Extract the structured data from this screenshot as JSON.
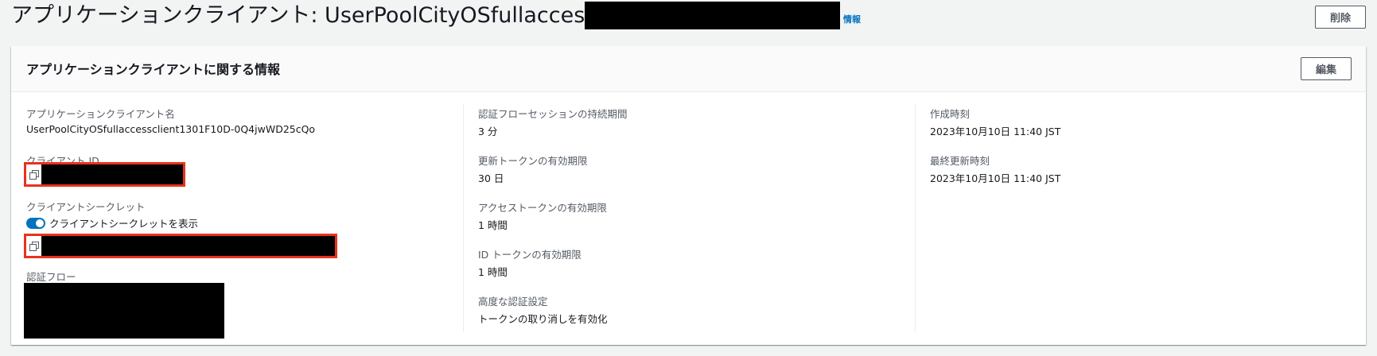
{
  "header": {
    "title": "アプリケーションクライアント: UserPoolCityOSfullaccessclient",
    "info_link": "情報",
    "delete_label": "削除"
  },
  "panel": {
    "title": "アプリケーションクライアントに関する情報",
    "edit_label": "編集"
  },
  "left": {
    "client_name_label": "アプリケーションクライアント名",
    "client_name_value": "UserPoolCityOSfullaccessclient1301F10D-0Q4jwWD25cQo",
    "client_id_label": "クライアント ID",
    "client_secret_label": "クライアントシークレット",
    "show_secret_label": "クライアントシークレットを表示",
    "show_secret_on": true,
    "auth_flow_label": "認証フロー"
  },
  "middle": {
    "auth_session_label": "認証フローセッションの持続期間",
    "auth_session_value": "3 分",
    "refresh_token_label": "更新トークンの有効期限",
    "refresh_token_value": "30 日",
    "access_token_label": "アクセストークンの有効期限",
    "access_token_value": "1 時間",
    "id_token_label": "ID トークンの有効期限",
    "id_token_value": "1 時間",
    "advanced_auth_label": "高度な認証設定",
    "advanced_auth_value": "トークンの取り消しを有効化"
  },
  "right": {
    "created_label": "作成時刻",
    "created_value": "2023年10月10日 11:40 JST",
    "updated_label": "最終更新時刻",
    "updated_value": "2023年10月10日 11:40 JST"
  },
  "colors": {
    "link": "#0073bb",
    "highlight_border": "#e8321c",
    "toggle_on": "#0073bb"
  },
  "icons": [
    "copy-icon",
    "copy-icon"
  ]
}
